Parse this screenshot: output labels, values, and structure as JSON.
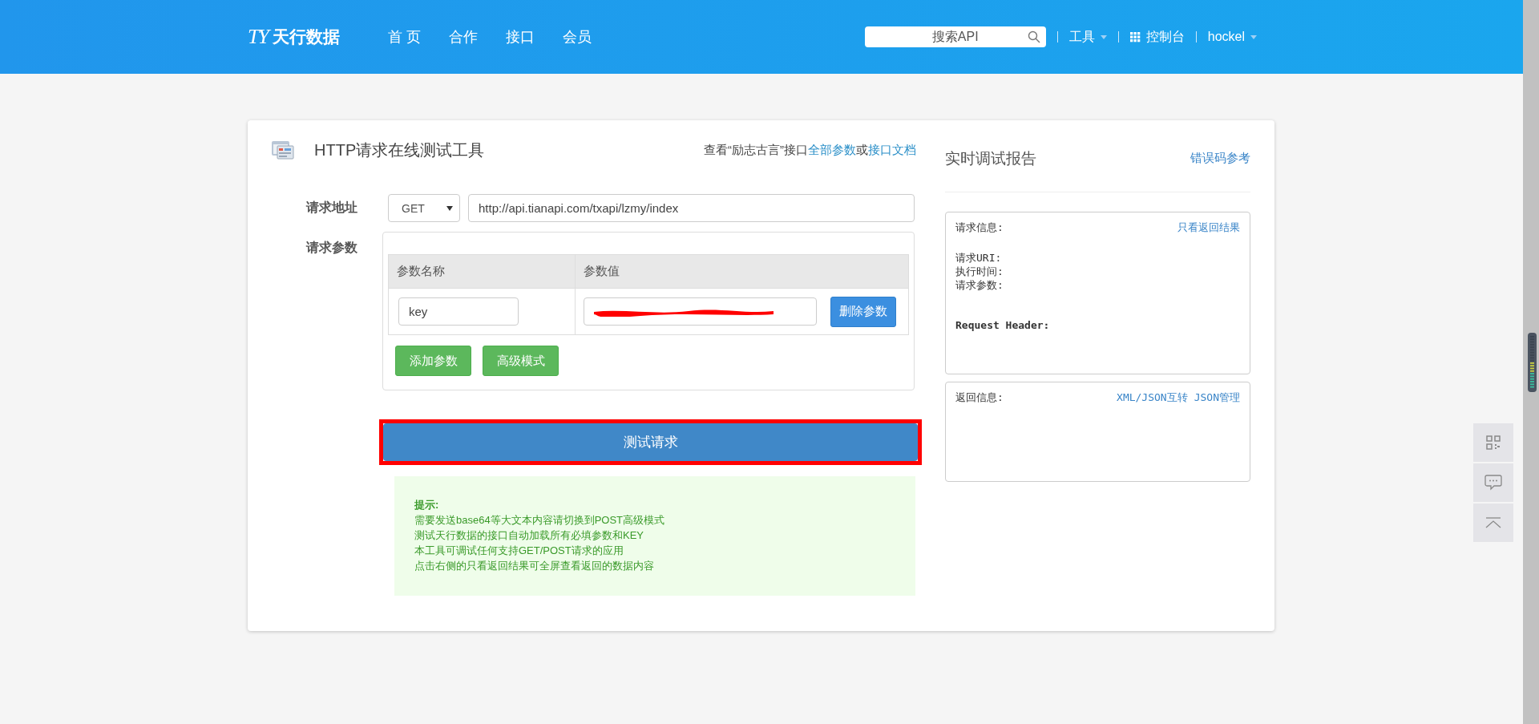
{
  "header": {
    "logo_mark": "TY",
    "logo_text": "天行数据",
    "nav": [
      {
        "label": "首 页",
        "selected": false
      },
      {
        "label": "合作",
        "selected": false
      },
      {
        "label": "接口",
        "selected": false
      },
      {
        "label": "会员",
        "selected": false
      }
    ],
    "search": {
      "placeholder": "搜索API"
    },
    "tools": "工具",
    "console": "控制台",
    "user": "hockel"
  },
  "tool": {
    "title": "HTTP请求在线测试工具",
    "doc_prefix": "查看“励志古言”接口",
    "doc_link_1": "全部参数",
    "doc_mid": "或",
    "doc_link_2": "接口文档",
    "url_label": "请求地址",
    "method": "GET",
    "url": "http://api.tianapi.com/txapi/lzmy/index",
    "params_label": "请求参数",
    "columns": [
      "参数名称",
      "参数值"
    ],
    "params": [
      {
        "name": "key",
        "value_redacted": true,
        "delete": "删除参数"
      }
    ],
    "add_button": "添加参数",
    "advanced_button": "高级模式",
    "submit": "测试请求",
    "submit_highlighted": true,
    "tips_title": "提示:",
    "tips": [
      "需要发送base64等大文本内容请切换到POST高级模式",
      "测试天行数据的接口自动加载所有必填参数和KEY",
      "本工具可调试任何支持GET/POST请求的应用",
      "点击右侧的只看返回结果可全屏查看返回的数据内容"
    ]
  },
  "report": {
    "title": "实时调试报告",
    "error_link": "错误码参考",
    "request_label": "请求信息:",
    "request_link": "只看返回结果",
    "fields": [
      "请求URI:",
      "执行时间:",
      "请求参数:"
    ],
    "header_label": "Request Header:",
    "response_label": "返回信息:",
    "response_links": [
      "XML/JSON互转",
      "JSON管理"
    ]
  }
}
